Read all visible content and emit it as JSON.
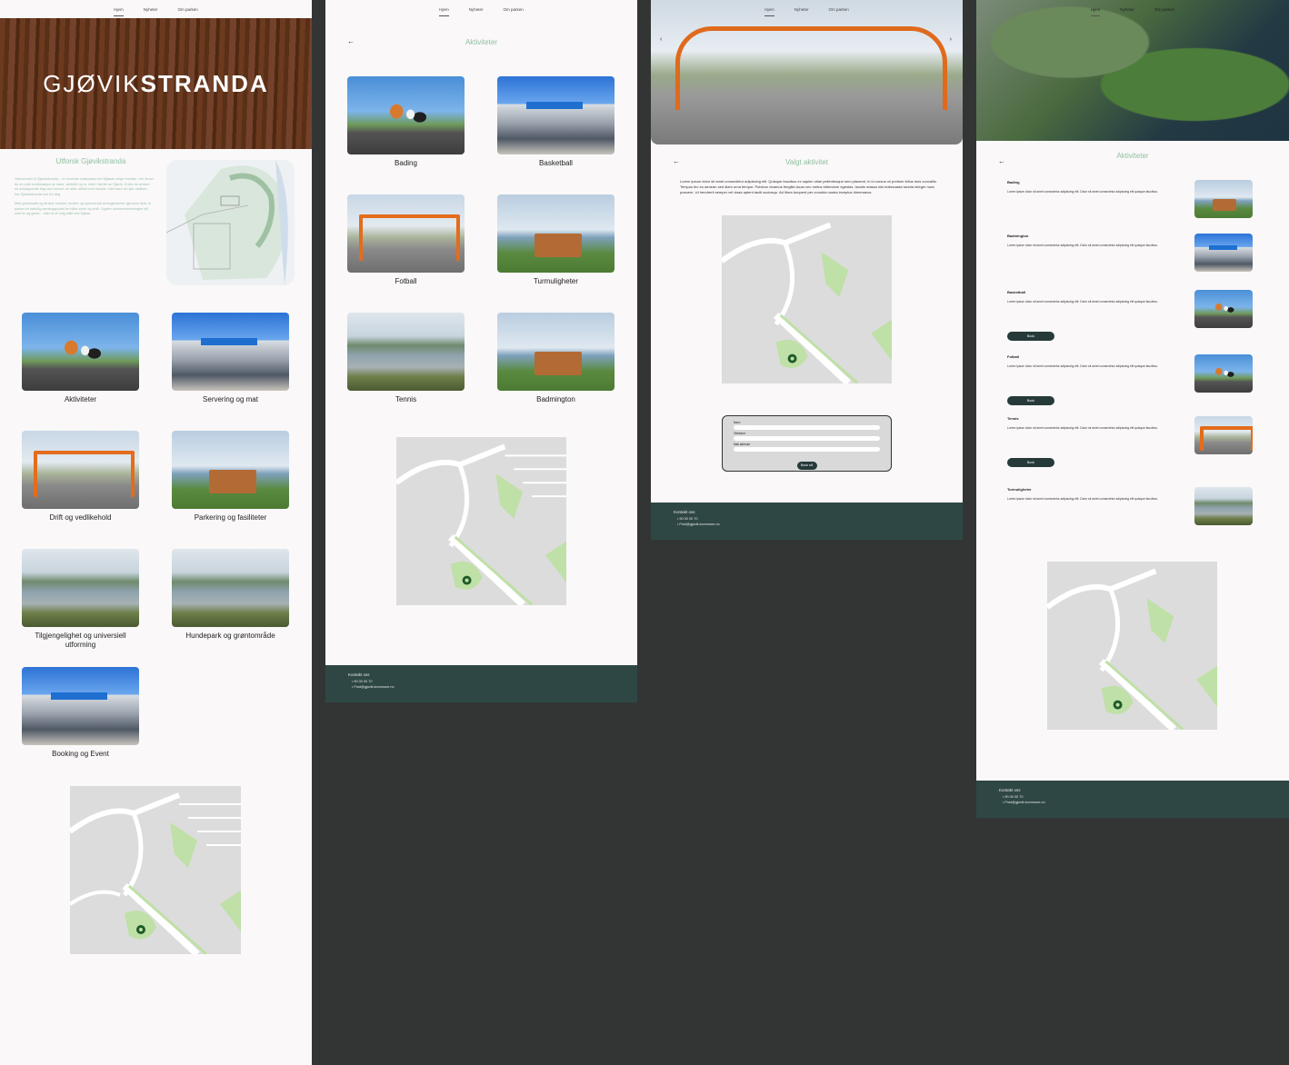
{
  "nav": {
    "items": [
      "Hjem",
      "Nyheter",
      "Om parken"
    ],
    "active": "Hjem"
  },
  "home": {
    "logo_left": "GJØVIK",
    "logo_right": "STRANDA",
    "intro_title": "Utforsk Gjøvikstranda",
    "intro_p1": "Velkommen til Gjøvikstranda – en levende møteplass ved Mjøsas rolige bredder. Her finner du en unik kombinasjon av natur, aktivitet og ro, midt i hjertet av Gjøvik. Enten du ønsker en avslappende dag ved vannet, en aktiv utflukt med familie, eller bare vil nyte utsikten, har Gjøvikstranda noe for deg.",
    "intro_p2": "Med gressmark og strand, kiosker, turstier og spennende arrangementer gjennom året, er parken et naturlig samlingspunkt for både store og små. Opplev sommerstemningen fylt med liv og glede – eller ta et rolig stille ved Mjøsa.",
    "tiles": [
      {
        "label": "Aktiviteter",
        "img": "basket"
      },
      {
        "label": "Servering og mat",
        "img": "building"
      },
      {
        "label": "Drift og vedlikehold",
        "img": "gym"
      },
      {
        "label": "Parkering og fasiliteter",
        "img": "bench"
      },
      {
        "label": "Tilgjengelighet og universiell utforming",
        "img": "lake"
      },
      {
        "label": "Hundepark og grøntområde",
        "img": "lake"
      },
      {
        "label": "Booking og Event",
        "img": "building"
      }
    ]
  },
  "activities": {
    "title": "Aktiviteter",
    "tiles": [
      {
        "label": "Bading",
        "img": "basket"
      },
      {
        "label": "Basketball",
        "img": "building"
      },
      {
        "label": "Fotball",
        "img": "gym"
      },
      {
        "label": "Turmuligheter",
        "img": "bench"
      },
      {
        "label": "Tennis",
        "img": "lake"
      },
      {
        "label": "Badmington",
        "img": "bench"
      }
    ]
  },
  "selected": {
    "title": "Valgt aktivitet",
    "body": "Lorem ipsum dolor sit amet consectetur adipiscing elit. Quisque faucibus ex sapien vitae pellentesque sem placerat. In id cursus mi pretium tellus duis convallis. Tempus leo eu aenean sed diam urna tempor. Pulvinar vivamus fringilla lacus nec metus bibendum egestas. Iaculis massa nisl malesuada lacinia integer nunc posuere. Ut hendrerit semper vel class aptent taciti sociosqu. Ad litora torquent per conubia nostra inceptos himenaeos.",
    "form": {
      "field1": "Navn",
      "field2": "Telefonnr",
      "field3": "Mail adresse",
      "submit": "Book nå"
    }
  },
  "list": {
    "title": "Aktiviteter",
    "desc": "Lorem ipsum dolor sit amet consectetur adipiscing elit. Dolor sit amet consectetur adipiscing elit quisque faucibus.",
    "book_label": "Book",
    "items": [
      {
        "name": "Bading",
        "img": "bench",
        "book": false
      },
      {
        "name": "Badmington",
        "img": "building",
        "book": false
      },
      {
        "name": "Basketball",
        "img": "basket",
        "book": true
      },
      {
        "name": "Fotball",
        "img": "basket",
        "book": true
      },
      {
        "name": "Tennis",
        "img": "gym",
        "book": true
      },
      {
        "name": "Turmuligheter",
        "img": "lake",
        "book": false
      }
    ]
  },
  "footer": {
    "title": "Kontakt oss",
    "phone": "90 00 00 70",
    "email": "Post@gjovik.kommune.no"
  }
}
